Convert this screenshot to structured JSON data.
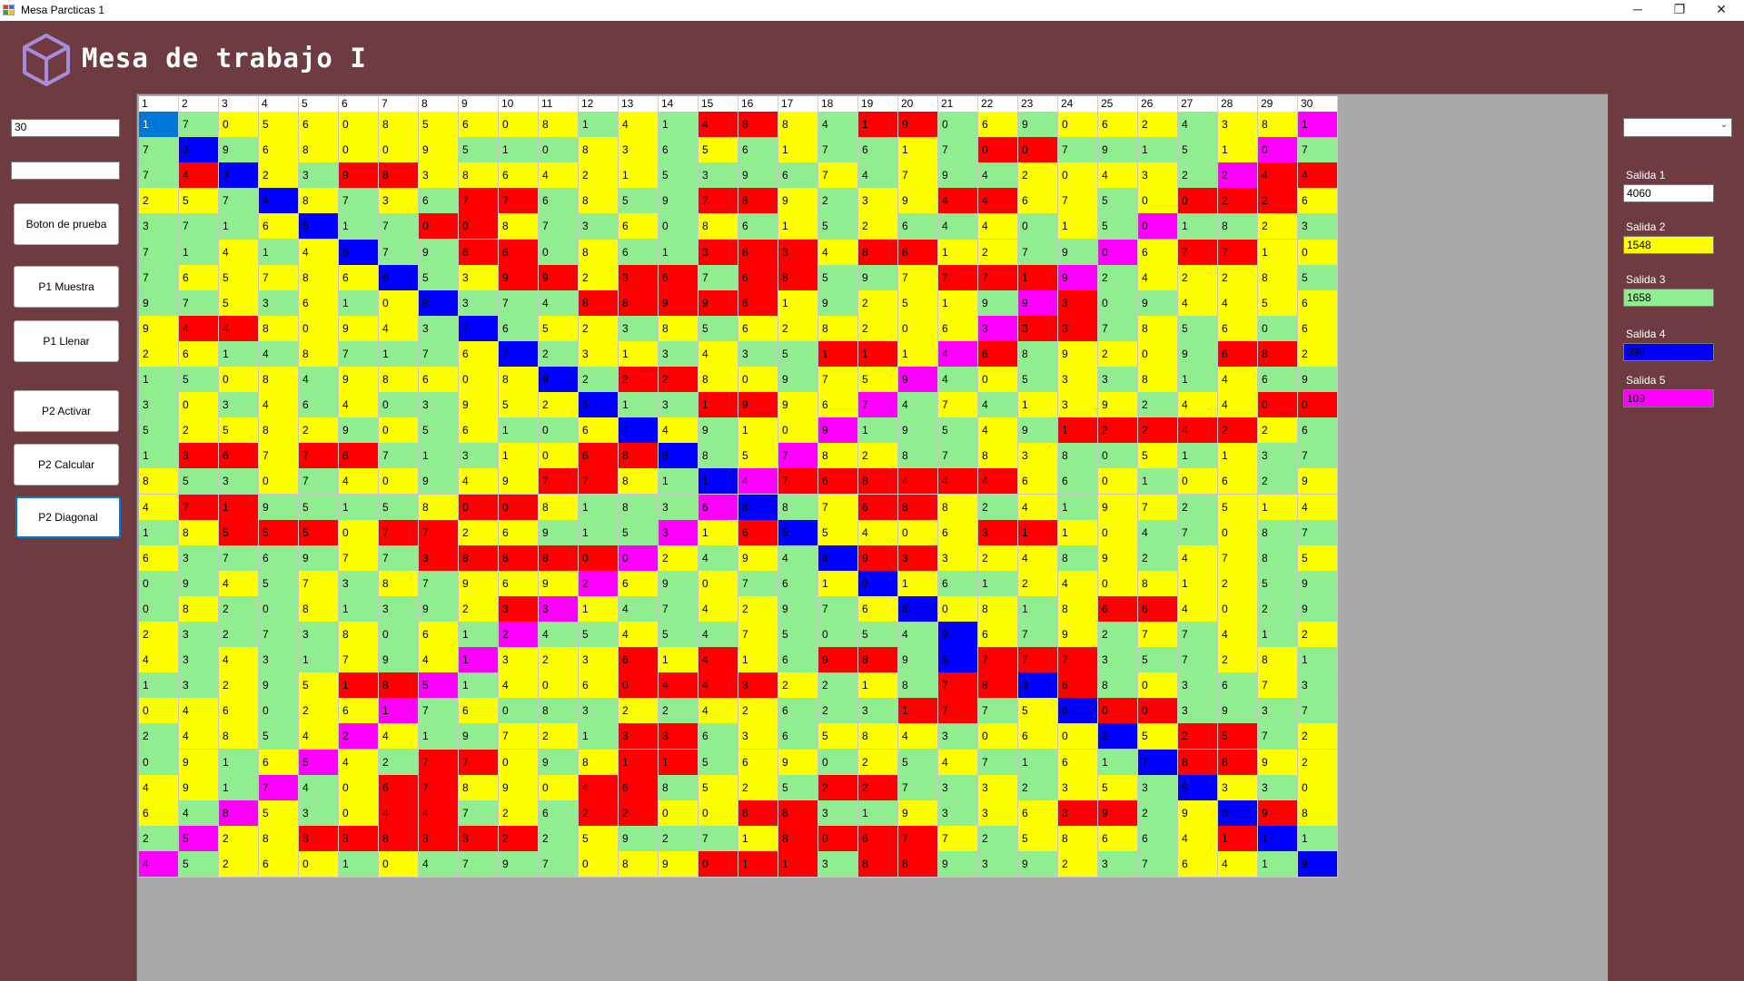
{
  "window": {
    "title": "Mesa Parcticas 1",
    "minimize": "─",
    "restore": "❐",
    "close": "✕"
  },
  "header": {
    "title": "Mesa de trabajo I",
    "logo_icon": "cube-icon"
  },
  "left": {
    "input1": "30",
    "input2": "",
    "buttons": [
      "Boton de prueba",
      "P1 Muestra",
      "P1 Llenar",
      "P2 Activar",
      "P2 Calcular",
      "P2 Diagonal"
    ]
  },
  "right": {
    "combo_value": "",
    "outputs": [
      {
        "label": "Salida 1",
        "value": "4060",
        "color": "#ffffff"
      },
      {
        "label": "Salida 2",
        "value": "1548",
        "color": "#ffff00"
      },
      {
        "label": "Salida 3",
        "value": "1658",
        "color": "#90ee90"
      },
      {
        "label": "Salida 4",
        "value": "398",
        "color": "#0000ff"
      },
      {
        "label": "Salida 5",
        "value": "109",
        "color": "#ff00ff"
      }
    ]
  },
  "colors": {
    "Y": "#ffff00",
    "G": "#90ee90",
    "R": "#ff0000",
    "B": "#0000ff",
    "M": "#ff00ff",
    "S": "#0078d7"
  },
  "grid": {
    "headers": [
      "1",
      "2",
      "3",
      "4",
      "5",
      "6",
      "7",
      "8",
      "9",
      "10",
      "11",
      "12",
      "13",
      "14",
      "15",
      "16",
      "17",
      "18",
      "19",
      "20",
      "21",
      "22",
      "23",
      "24",
      "25",
      "26",
      "27",
      "28",
      "29",
      "30"
    ],
    "rows": [
      {
        "v": "170560856081414884190690624381",
        "c": "SGYYYYYYYYYGYGRRYGRRGYGYYYGYYM"
      },
      {
        "v": "739680095108365617617007915107",
        "c": "GBGYYYYYGGGYYGYGYGGYGRRGGGGYMG"
      },
      {
        "v": "743239838642153967479420432244",
        "c": "GRBYGRRYYYYYYGGGGYGYGGYYYYGMRR"
      },
      {
        "v": "257487367768597892394467500226",
        "c": "YYGBYGYGRRGYGGRRYGYYRRYYGYRRRY"
      },
      {
        "v": "371651700873608615264401501823",
        "c": "GGGYBGGRRYGGYGYGYGYGGYGYGMGGYG"
      },
      {
        "v": "714146796608613834881279067710",
        "c": "GGYGYBGGRRGYGGRRRYRRYYGGMYRRYY"
      },
      {
        "v": "765786653992367685977719242285",
        "c": "GYYYYYBGYRRYRRGRRGGYRRRMGYYYYG"
      },
      {
        "v": "975361083748899619251993094456",
        "c": "GGYGYGYBGGGRRRRRYGYYYGMRGGYYYY"
      },
      {
        "v": "944809437652385628206333785606",
        "c": "YRRYYYYGBGYYGYGYYYYYYMRRGYGYGY"
      },
      {
        "v": "261487176723134351114689209682",
        "c": "YYGGYGGGYBGYYGYGGRRYMRGYYYGRRY"
      },
      {
        "v": "150849860892228097594053381469",
        "c": "GGYYGYYYYYBGRRYYGYYMGYGYGYGYGG"
      },
      {
        "v": "303464039525131996747413924400",
        "c": "GYGYGYGGYYYBGGRRYYMGYGYYYGYYRR"
      },
      {
        "v": "525829056106449109195491224226",
        "c": "GYYYYGYGYGGYBYGYYMGGGYGRRRRRY"
      },
      {
        "v": "136776713106888578287838051137",
        "c": "GRRYRRGGGYYRRBGYMYYGGYYGGYGYGG"
      },
      {
        "v": "853074094977811476844466010629",
        "c": "YGGYGYYGYYRRYGBMRRRRRRYGYGYYGY"
      },
      {
        "v": "471951580081836887688241972514",
        "c": "YRRGGGGYRRYGGGMBGYRRYGYGYYGYYY"
      },
      {
        "v": "185550772691531655406311047087",
        "c": "GYRRRYRRYYGGGMYRBYYYYRRYYGGYGG"
      },
      {
        "v": "637697738880024948933248924785",
        "c": "YGGGGYGRRRRRMYGYGBRRYYYGYGYYGY"
      },
      {
        "v": "094573879692690761016124081259",
        "c": "GGYGYGYGYYYMYGYGGYBYGGYYYYYYGG"
      },
      {
        "v": "082081392331474297680818664029",
        "c": "GYGGYGGGYRMYGGYYGGYBYYGYRRYYGG"
      },
      {
        "v": "232738061245454750549679277412",
        "c": "YGGGGYGYGMGGYGGYGGGGBYGYGYGYGY"
      },
      {
        "v": "434317941323614169895777357281",
        "c": "YGYGGYGYMYYYRYRYGRRGBRRRGGGYYG"
      },
      {
        "v": "132951851406044322187836803673",
        "c": "GGYGYRRMGYYYRRRRYGYGRRBRGYGGYG"
      },
      {
        "v": "046026176083224262317756003937",
        "c": "YYYGYYMGYGGGYGYYGGGRRGYBRRGGGG"
      },
      {
        "v": "248542419721336365843060252572",
        "c": "GYYGYMYGGYYGRRGYGYYYGYYYBYRRGY"
      },
      {
        "v": "091654277098115690254716178892",
        "c": "GYGYMYGRRYGYRRGYYGYGYGGYGBRRYY"
      },
      {
        "v": "491740678904685252273323535330",
        "c": "YYGMGYRRYYYRRGYYGRRGGYGYYGBYGY"
      },
      {
        "v": "648530447262200883193363929398",
        "c": "YGMYGYRRGYGRRYYRRGGYGYYRRGYBRY"
      },
      {
        "v": "252833833225927180677258664111",
        "c": "GMYYRRRRRRGYGGGYRRRRYGYYYGYRBG"
      },
      {
        "v": "452601047970890113889392376419",
        "c": "MGYYYGYGGGGYYYRRRGRRGGGYGGYYGB"
      }
    ]
  }
}
